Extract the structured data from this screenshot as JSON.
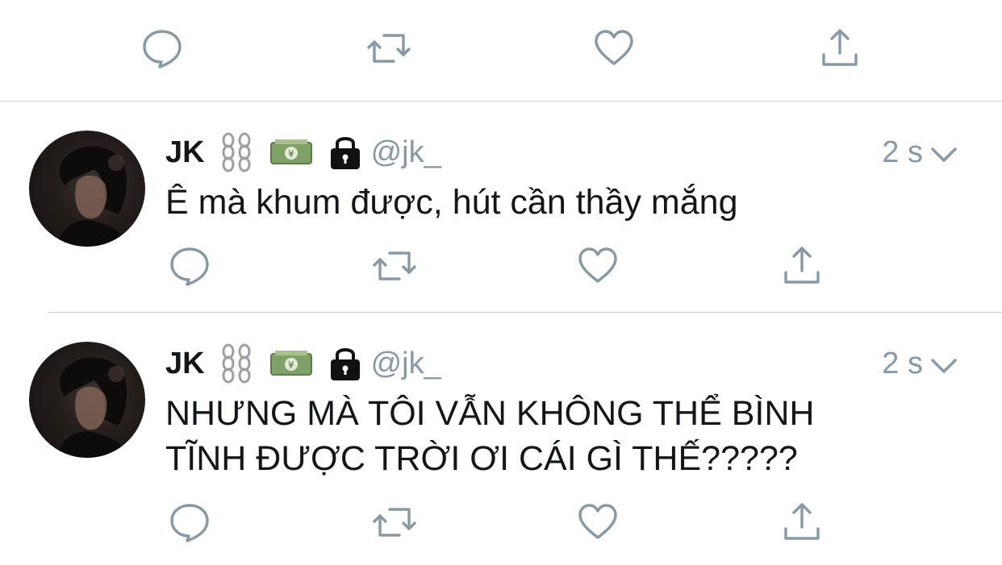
{
  "tweets": [
    {
      "name": "JK",
      "name_emojis": [
        "chain-icon",
        "money-icon",
        "lock-icon"
      ],
      "handle": "@jk_",
      "time": "2 s",
      "text": "Ê mà khum được, hút cần thầy mắng"
    },
    {
      "name": "JK",
      "name_emojis": [
        "chain-icon",
        "money-icon",
        "lock-icon"
      ],
      "handle": "@jk_",
      "time": "2 s",
      "text": "NHƯNG MÀ TÔI VẪN KHÔNG THỂ BÌNH TĨNH ĐƯỢC TRỜI ƠI CÁI GÌ THẾ?????"
    }
  ],
  "actions": [
    "reply-icon",
    "retweet-icon",
    "like-icon",
    "share-icon"
  ],
  "colors": {
    "text": "#14171a",
    "muted": "#8899a6",
    "divider": "#c8ccd0",
    "background": "#ffffff"
  }
}
